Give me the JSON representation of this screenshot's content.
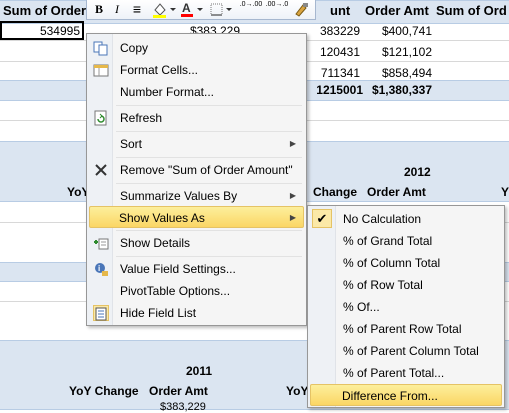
{
  "sheet": {
    "header_row": {
      "sum_of_order": "Sum of Order",
      "amount_partial": "unt",
      "order_amt": "Order Amt",
      "sum_of_order_right": "Sum of Ord"
    },
    "data_rows": [
      {
        "a": "534995",
        "b": "$383,229",
        "c": "383229",
        "d": "$400,741"
      },
      {
        "c": "120431",
        "d": "$121,102"
      },
      {
        "c": "711341",
        "d": "$858,494"
      }
    ],
    "total_row": {
      "c": "1215001",
      "d": "$1,380,337"
    },
    "section2": {
      "year": "2012",
      "yoy_left": "YoY",
      "change": "Change",
      "order_amt": "Order Amt",
      "yoy_right": "Y"
    },
    "section3": {
      "year": "2011",
      "yoy_change": "YoY Change",
      "order_amt": "Order Amt",
      "yoy_partial": "YoY"
    },
    "bottom_partial": "$383,229"
  },
  "minibar": {
    "bold": "B",
    "italic": "I",
    "align": "≡",
    "decrease_decimals": ".0→.00",
    "increase_decimals": ".00→.0"
  },
  "context_menu": {
    "items": [
      {
        "label": "Copy",
        "icon": "copy-icon"
      },
      {
        "label": "Format Cells...",
        "icon": "format-cells-icon"
      },
      {
        "label": "Number Format...",
        "icon": ""
      },
      {
        "label": "Refresh",
        "icon": "refresh-icon"
      },
      {
        "label": "Sort",
        "icon": ""
      },
      {
        "label": "Remove \"Sum of Order Amount\"",
        "icon": "remove-icon"
      },
      {
        "label": "Summarize Values By",
        "icon": ""
      },
      {
        "label": "Show Values As",
        "icon": ""
      },
      {
        "label": "Show Details",
        "icon": "show-details-icon"
      },
      {
        "label": "Value Field Settings...",
        "icon": "field-settings-icon"
      },
      {
        "label": "PivotTable Options...",
        "icon": ""
      },
      {
        "label": "Hide Field List",
        "icon": "field-list-icon"
      }
    ]
  },
  "submenu": {
    "items": [
      {
        "label": "No Calculation",
        "checked": true
      },
      {
        "label": "% of Grand Total"
      },
      {
        "label": "% of Column Total"
      },
      {
        "label": "% of Row Total"
      },
      {
        "label": "% Of..."
      },
      {
        "label": "% of Parent Row Total"
      },
      {
        "label": "% of Parent Column Total"
      },
      {
        "label": "% of Parent Total..."
      },
      {
        "label": "Difference From..."
      }
    ],
    "check_glyph": "✔"
  },
  "colors": {
    "band": "#dbe5f1",
    "highlight": "#fbd665",
    "menu_bg": "#f5f5f5"
  }
}
